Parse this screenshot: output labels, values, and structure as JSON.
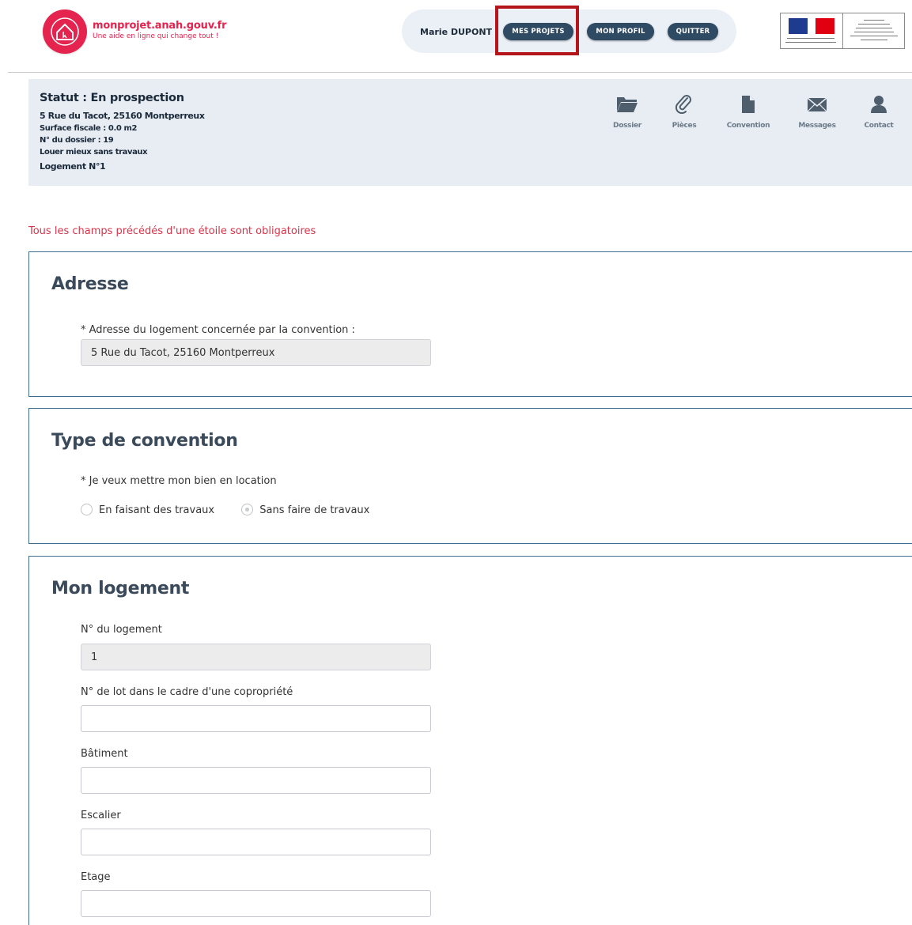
{
  "header": {
    "logo_title": "monprojet.anah.gouv.fr",
    "logo_tagline": "Une aide en ligne qui change tout !",
    "user_name": "Marie DUPONT",
    "nav_buttons": [
      "MES PROJETS",
      "MON PROFIL",
      "QUITTER"
    ],
    "brand_color": "#e4244e",
    "button_color": "#2f4a63"
  },
  "status": {
    "title": "Statut : En prospection",
    "address": "5 Rue du Tacot, 25160 Montperreux",
    "surface": "Surface fiscale : 0.0 m2",
    "dossier": "N° du dossier : 19",
    "programme": "Louer mieux sans travaux",
    "logement": "Logement N°1",
    "nav": [
      {
        "label": "Dossier",
        "icon": "folder-icon"
      },
      {
        "label": "Pièces",
        "icon": "paperclip-icon"
      },
      {
        "label": "Convention",
        "icon": "document-icon"
      },
      {
        "label": "Messages",
        "icon": "envelope-icon"
      },
      {
        "label": "Contact",
        "icon": "person-icon"
      }
    ]
  },
  "form": {
    "required_note": "Tous les champs précédés d'une étoile sont obligatoires",
    "adresse": {
      "title": "Adresse",
      "label": "* Adresse du logement concernée par la convention :",
      "value": "5 Rue du Tacot, 25160 Montperreux"
    },
    "convention": {
      "title": "Type de convention",
      "label": "* Je veux mettre mon bien en location",
      "options": [
        "En faisant des travaux",
        "Sans faire de travaux"
      ],
      "selected": "Sans faire de travaux"
    },
    "logement": {
      "title": "Mon logement",
      "numero_label": "N° du logement",
      "numero_value": "1",
      "lot_label": "N° de lot dans le cadre d'une copropriété",
      "lot_value": "",
      "batiment_label": "Bâtiment",
      "batiment_value": "",
      "escalier_label": "Escalier",
      "escalier_value": "",
      "etage_label": "Etage",
      "etage_value": ""
    }
  }
}
